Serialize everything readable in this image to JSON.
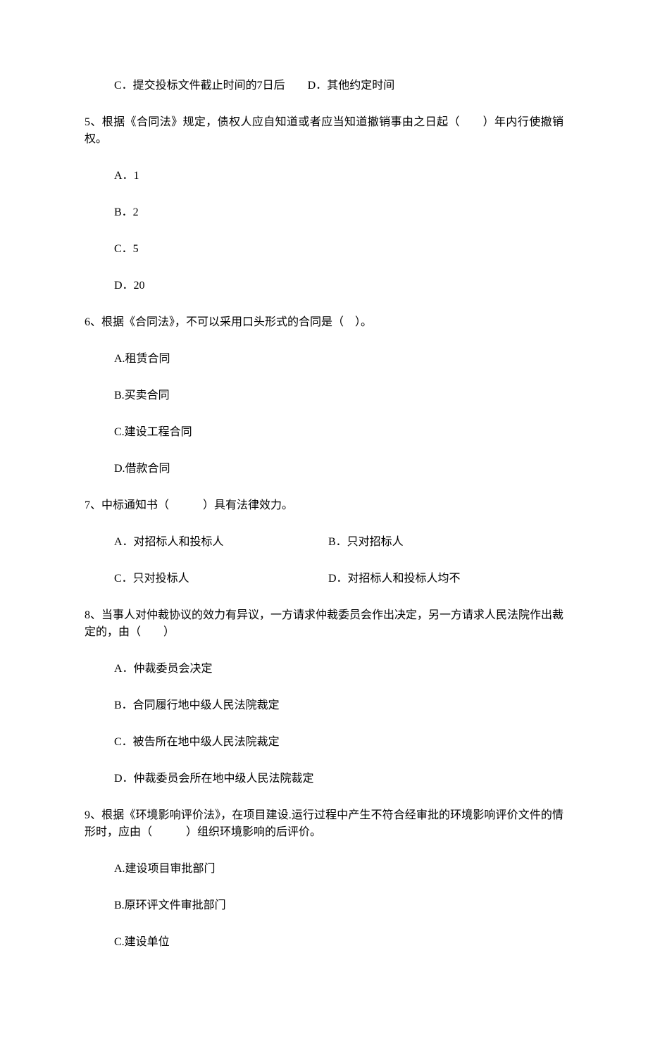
{
  "prev_line": "C．提交投标文件截止时间的7日后　　D．其他约定时间",
  "q5": {
    "stem": "5、根据《合同法》规定，债权人应自知道或者应当知道撤销事由之日起（　　）年内行使撤销权。",
    "optA": "A．1",
    "optB": "B．2",
    "optC": "C．5",
    "optD": "D．20"
  },
  "q6": {
    "stem": "6、根据《合同法》，不可以采用口头形式的合同是（　）。",
    "optA": "A.租赁合同",
    "optB": "B.买卖合同",
    "optC": "C.建设工程合同",
    "optD": "D.借款合同"
  },
  "q7": {
    "stem": "7、中标通知书（　　　）具有法律效力。",
    "optA": "A．对招标人和投标人",
    "optB": "B．只对招标人",
    "optC": "C．只对投标人",
    "optD": "D．对招标人和投标人均不"
  },
  "q8": {
    "stem": "8、当事人对仲裁协议的效力有异议，一方请求仲裁委员会作出决定，另一方请求人民法院作出裁定的，由（　　）",
    "optA": "A．仲裁委员会决定",
    "optB": "B．合同履行地中级人民法院裁定",
    "optC": "C．被告所在地中级人民法院裁定",
    "optD": "D．仲裁委员会所在地中级人民法院裁定"
  },
  "q9": {
    "stem": "9、根据《环境影响评价法》，在项目建设.运行过程中产生不符合经审批的环境影响评价文件的情形时，应由（　　　）组织环境影响的后评价。",
    "optA": "A.建设项目审批部门",
    "optB": "B.原环评文件审批部门",
    "optC": "C.建设单位"
  }
}
